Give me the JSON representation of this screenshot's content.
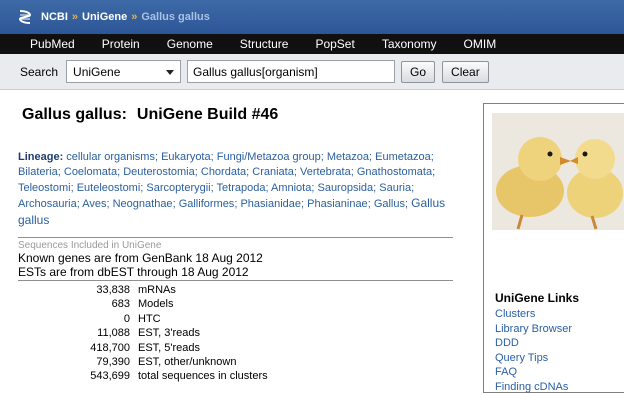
{
  "breadcrumb": [
    "NCBI",
    "UniGene",
    "Gallus gallus"
  ],
  "breadcrumb_separator": "»",
  "nav": [
    "PubMed",
    "Protein",
    "Genome",
    "Structure",
    "PopSet",
    "Taxonomy",
    "OMIM"
  ],
  "search": {
    "label": "Search",
    "database": "UniGene",
    "term": "Gallus gallus[organism]",
    "go_label": "Go",
    "clear_label": "Clear"
  },
  "title": {
    "organism": "Gallus gallus:",
    "build": "UniGene Build #46"
  },
  "lineage": {
    "label": "Lineage:",
    "taxa": [
      "cellular organisms",
      "Eukaryota",
      "Fungi/Metazoa group",
      "Metazoa",
      "Eumetazoa",
      "Bilateria",
      "Coelomata",
      "Deuterostomia",
      "Chordata",
      "Craniata",
      "Vertebrata",
      "Gnathostomata",
      "Teleostomi",
      "Euteleostomi",
      "Sarcopterygii",
      "Tetrapoda",
      "Amniota",
      "Sauropsida",
      "Sauria",
      "Archosauria",
      "Aves",
      "Neognathae",
      "Galliformes",
      "Phasianidae",
      "Phasianinae",
      "Gallus"
    ],
    "species": "Gallus gallus"
  },
  "sequences": {
    "heading": "Sequences Included in UniGene",
    "genes_note": "Known genes are from GenBank 18 Aug 2012",
    "ests_note": "ESTs are from dbEST through 18 Aug 2012",
    "rows": [
      {
        "count": "33,838",
        "type": "mRNAs"
      },
      {
        "count": "683",
        "type": "Models"
      },
      {
        "count": "0",
        "type": "HTC"
      },
      {
        "count": "11,088",
        "type": "EST, 3'reads"
      },
      {
        "count": "418,700",
        "type": "EST, 5'reads"
      },
      {
        "count": "79,390",
        "type": "EST, other/unknown"
      },
      {
        "count": "543,699",
        "type": "total sequences in clusters"
      }
    ]
  },
  "sidebar": {
    "links_heading": "UniGene Links",
    "links": [
      "Clusters",
      "Library Browser",
      "DDD",
      "Query Tips",
      "FAQ",
      "Finding cDNAs"
    ]
  },
  "colors": {
    "topbar": "#2f5b9b",
    "navbar": "#101010",
    "link": "#2b5f9e",
    "separator": "#e6b24a"
  },
  "icons": [
    "ncbi-helix-icon",
    "chevron-down-icon"
  ]
}
